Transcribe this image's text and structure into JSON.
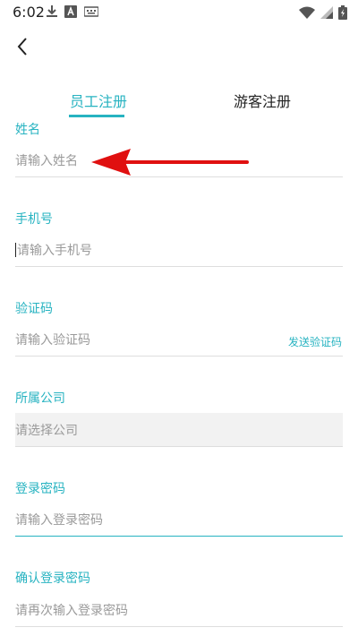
{
  "status_bar": {
    "time": "6:02",
    "icons_left": [
      "download-icon",
      "a-icon",
      "keyboard-icon"
    ],
    "icons_right": [
      "wifi-icon",
      "signal-icon",
      "battery-icon"
    ]
  },
  "nav": {
    "back_icon": "chevron-left-icon"
  },
  "tabs": [
    {
      "label": "员工注册",
      "active": true
    },
    {
      "label": "游客注册",
      "active": false
    }
  ],
  "form": {
    "name": {
      "label": "姓名",
      "placeholder": "请输入姓名"
    },
    "phone": {
      "label": "手机号",
      "placeholder": "请输入手机号"
    },
    "code": {
      "label": "验证码",
      "placeholder": "请输入验证码",
      "action": "发送验证码"
    },
    "company": {
      "label": "所属公司",
      "placeholder": "请选择公司"
    },
    "password": {
      "label": "登录密码",
      "placeholder": "请输入登录密码"
    },
    "confirm_password": {
      "label": "确认登录密码",
      "placeholder": "请再次输入登录密码"
    }
  },
  "colors": {
    "accent": "#27b3c1",
    "annotation_arrow": "#e01010"
  }
}
